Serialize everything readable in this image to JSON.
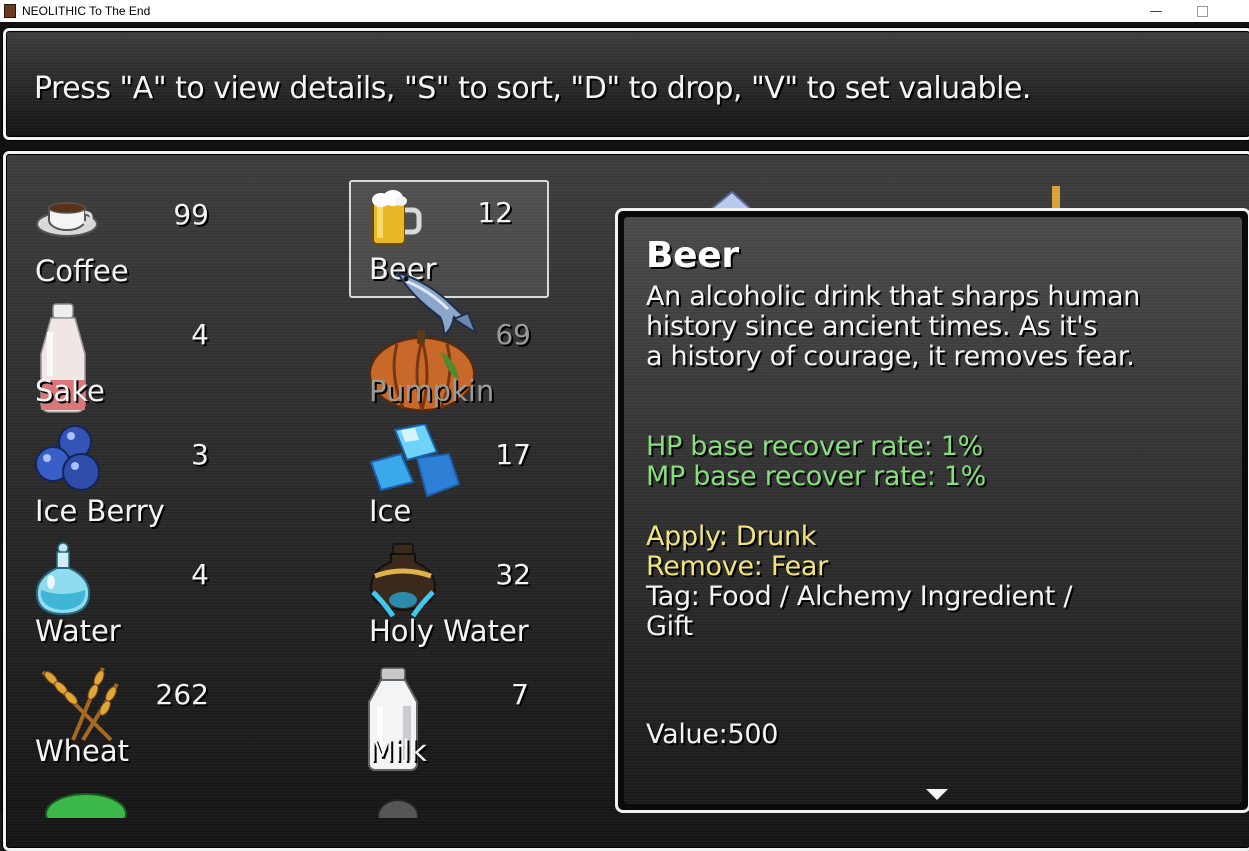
{
  "window": {
    "title": "NEOLITHIC To The End"
  },
  "help": {
    "text": "Press \"A\" to view details, \"S\" to sort, \"D\" to drop, \"V\" to set valuable."
  },
  "inventory": {
    "items": [
      {
        "name": "Coffee",
        "count": "99",
        "icon": "coffee-cup-icon"
      },
      {
        "name": "Beer",
        "count": "12",
        "icon": "beer-mug-icon",
        "selected": true
      },
      {
        "name": "Sake",
        "count": "4",
        "icon": "sake-bottle-icon"
      },
      {
        "name": "Pumpkin",
        "count": "69",
        "icon": "pumpkin-icon",
        "dimmed": true
      },
      {
        "name": "Ice Berry",
        "count": "3",
        "icon": "ice-berry-icon"
      },
      {
        "name": "Ice",
        "count": "17",
        "icon": "ice-crystal-icon"
      },
      {
        "name": "Water",
        "count": "4",
        "icon": "water-flask-icon"
      },
      {
        "name": "Holy Water",
        "count": "32",
        "icon": "holy-water-icon"
      },
      {
        "name": "Wheat",
        "count": "262",
        "icon": "wheat-icon"
      },
      {
        "name": "Milk",
        "count": "7",
        "icon": "milk-bottle-icon"
      }
    ]
  },
  "detail": {
    "title": "Beer",
    "description": [
      "An alcoholic drink that sharps human",
      "history since ancient times. As it's",
      "a history of courage, it removes fear."
    ],
    "stats": [
      "HP base recover rate: 1%",
      "MP base recover rate: 1%"
    ],
    "apply": "Apply: Drunk",
    "remove": "Remove: Fear",
    "tag_lines": [
      "Tag: Food / Alchemy Ingredient /",
      "Gift"
    ],
    "value": "Value:500"
  },
  "colors": {
    "stat_text": "#86e07a",
    "effect_text": "#f2e47a",
    "window_border": "#f2f2f2"
  }
}
